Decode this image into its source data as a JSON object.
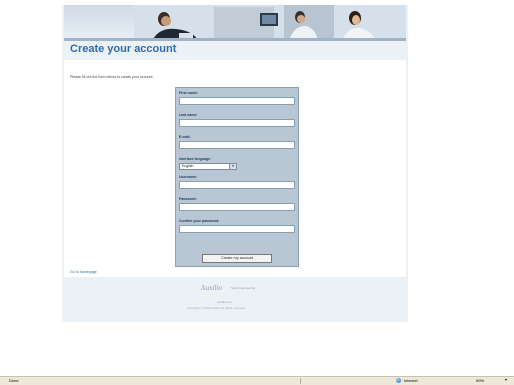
{
  "header": {
    "title": "Create your account"
  },
  "main": {
    "intro": "Please fill out the form below to create your account.",
    "home_link": "Go to homepage"
  },
  "form": {
    "first_name_label": "First name:",
    "last_name_label": "Last name:",
    "email_label": "E-mail:",
    "language_label": "Interface language:",
    "language_value": "English",
    "username_label": "Username:",
    "password_label": "Password:",
    "confirm_password_label": "Confirm your password:",
    "submit_label": "Create my account"
  },
  "footer": {
    "logo_text": "Auxilio",
    "logo_tagline": "Simply better learning",
    "link": "Auxilio.com",
    "copyright": "Copyright © 2008 Auxilio All rights reserved"
  },
  "statusbar": {
    "status": "Done",
    "zone": "Internet",
    "zoom": "90%"
  },
  "colors": {
    "accent": "#2f6da8",
    "form_panel": "#b9c7d5",
    "page_bg": "#ecf1f6"
  },
  "icons": {
    "zone": "globe-icon",
    "zoom": "magnifier-icon"
  }
}
